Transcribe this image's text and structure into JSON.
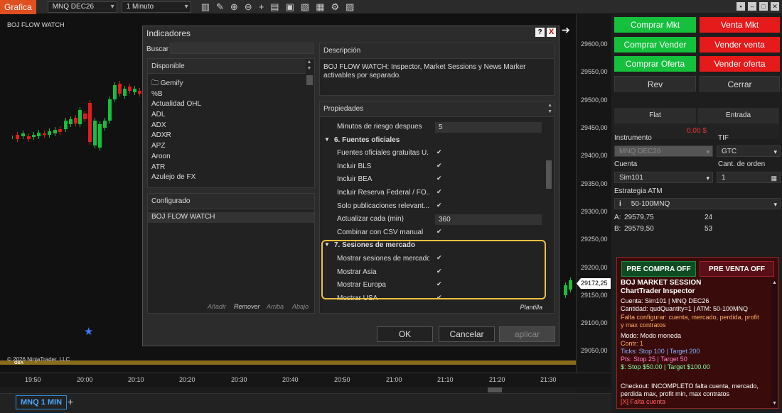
{
  "toolbar": {
    "tab_label": "Grafica",
    "instrument": "MNQ DEC26",
    "interval": "1 Minuto"
  },
  "chart": {
    "title": "BOJ FLOW WATCH",
    "copyright": "© 2026 NinjaTrader, LLC",
    "session_marker": "OSA",
    "price_tag": "29172,25",
    "f_button": "F",
    "price_labels": [
      "29600,00",
      "29550,00",
      "29500,00",
      "29450,00",
      "29400,00",
      "29350,00",
      "29300,00",
      "29250,00",
      "29200,00",
      "29150,00",
      "29100,00",
      "29050,00"
    ],
    "time_labels": [
      "19:50",
      "20:00",
      "20:10",
      "20:20",
      "20:30",
      "20:40",
      "20:50",
      "21:00",
      "21:10",
      "21:20",
      "21:30"
    ],
    "bottom_tab": "MNQ 1 MIN",
    "add_tab": "+",
    "colors": {
      "up": "#14c03c",
      "down": "#e51a1a",
      "session_bar": "#8a6d1a"
    }
  },
  "dialog": {
    "title": "Indicadores",
    "help": "?",
    "close": "X",
    "search_label": "Buscar",
    "available_header": "Disponible",
    "available_items": [
      "Gemify",
      "%B",
      "Actualidad OHL",
      "ADL",
      "ADX",
      "ADXR",
      "APZ",
      "Aroon",
      "ATR",
      "Azulejo de FX"
    ],
    "configured_header": "Configurado",
    "configured_items": [
      "BOJ FLOW WATCH"
    ],
    "actions": {
      "add": "Añadir",
      "remove": "Remover",
      "up": "Arriba",
      "down": "Abajo"
    },
    "description_header": "Descripción",
    "description_text": "BOJ FLOW WATCH: Inspector, Market Sessions y News Marker activables por separado.",
    "properties_header": "Propiedades",
    "template_label": "Plantilla",
    "ok": "OK",
    "cancel": "Cancelar",
    "apply": "aplicar",
    "properties": [
      {
        "type": "value",
        "label": "Minutos de riesgo despues",
        "value": "5"
      },
      {
        "type": "section",
        "label": "6. Fuentes oficiales"
      },
      {
        "type": "check",
        "label": "Fuentes oficiales gratuitas U...",
        "value": "✔"
      },
      {
        "type": "check",
        "label": "Incluir BLS",
        "value": "✔"
      },
      {
        "type": "check",
        "label": "Incluir BEA",
        "value": "✔"
      },
      {
        "type": "check",
        "label": "Incluir Reserva Federal / FO...",
        "value": "✔"
      },
      {
        "type": "check",
        "label": "Solo publicaciones relevant...",
        "value": "✔"
      },
      {
        "type": "value",
        "label": "Actualizar cada (min)",
        "value": "360"
      },
      {
        "type": "check",
        "label": "Combinar con CSV manual",
        "value": "✔"
      },
      {
        "type": "section",
        "label": "7. Sesiones de mercado"
      },
      {
        "type": "check",
        "label": "Mostrar sesiones de mercado",
        "value": "✔"
      },
      {
        "type": "check",
        "label": "Mostrar Asia",
        "value": "✔"
      },
      {
        "type": "check",
        "label": "Mostrar Europa",
        "value": "✔"
      },
      {
        "type": "check",
        "label": "Mostrar USA",
        "value": "✔"
      }
    ]
  },
  "trader": {
    "buy_mkt": "Comprar Mkt",
    "sell_mkt": "Venta Mkt",
    "buy_bid": "Comprar Vender",
    "sell_ask": "Vender venta",
    "buy_offer": "Comprar Oferta",
    "sell_offer": "Vender oferta",
    "rev": "Rev",
    "close": "Cerrar",
    "flat": "Flat",
    "entry": "Entrada",
    "pnl": "0,00 $",
    "instrument_label": "Instrumento",
    "instrument_value": "MNQ DEC26",
    "tif_label": "TIF",
    "tif_value": "GTC",
    "account_label": "Cuenta",
    "account_value": "Sim101",
    "qty_label": "Cant. de orden",
    "qty_value": "1",
    "atm_label": "Estrategia ATM",
    "atm_value": "50-100MNQ",
    "info_icon": "i",
    "ask_label": "A:",
    "ask_price": "29579,75",
    "ask_size": "24",
    "bid_label": "B:",
    "bid_price": "29579,50",
    "bid_size": "53"
  },
  "inspector": {
    "pre_buy": "PRE COMPRA OFF",
    "pre_sell": "PRE VENTA OFF",
    "title": "BOJ MARKET SESSION",
    "subtitle": "ChartTrader Inspector",
    "lines": [
      {
        "text": "Cuenta: Sim101 | MNQ DEC26",
        "color": "#ffffff"
      },
      {
        "text": "Cantidad: qudQuantity=1 | ATM: 50-100MNQ",
        "color": "#ffffff"
      },
      {
        "text": "Falta configurar: cuenta, mercado, perdida, profit",
        "color": "#ffb060"
      },
      {
        "text": "y max contratos",
        "color": "#ffb060"
      },
      {
        "text": "Modo: Modo moneda",
        "color": "#ffffff"
      },
      {
        "text": "Contr: 1",
        "color": "#ffb060"
      },
      {
        "text": "Ticks: Stop 100 | Target 200",
        "color": "#7fb0ff"
      },
      {
        "text": "Pts: Stop 25 | Target 50",
        "color": "#ff7fc8"
      },
      {
        "text": "$: Stop $50.00 | Target $100.00",
        "color": "#7fffa0"
      },
      {
        "text": "Checkout: INCOMPLETO falta cuenta, mercado,",
        "color": "#ffffff"
      },
      {
        "text": "perdida max, profit min, max contratos",
        "color": "#ffffff"
      },
      {
        "text": "[X] Falta cuenta",
        "color": "#ff6060"
      },
      {
        "text": "[X] Falta mercado",
        "color": "#ff6060"
      }
    ]
  }
}
